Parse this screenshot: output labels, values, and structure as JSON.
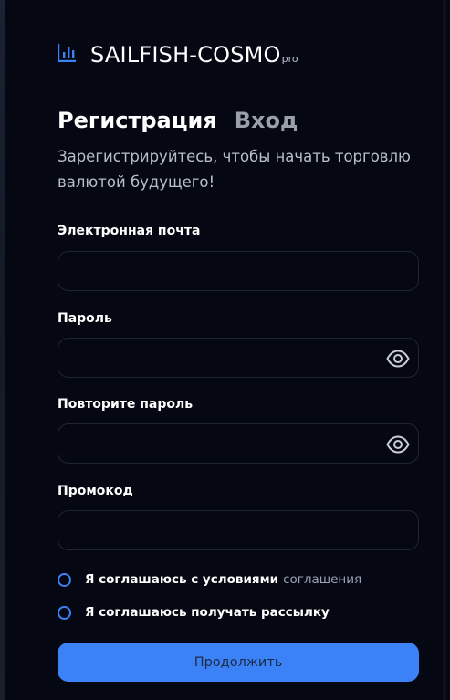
{
  "brand": {
    "name": "SAILFISH-COSMO",
    "suffix": "pro",
    "icon": "bar-chart-icon",
    "accent": "#3b82f6"
  },
  "tabs": {
    "register": "Регистрация",
    "login": "Вход"
  },
  "subtitle": "Зарегистрируйтесь, чтобы начать торговлю валютой будущего!",
  "fields": {
    "email": {
      "label": "Электронная почта",
      "value": "",
      "placeholder": ""
    },
    "password": {
      "label": "Пароль",
      "value": "",
      "placeholder": "",
      "icon": "eye-icon"
    },
    "password_repeat": {
      "label": "Повторите пароль",
      "value": "",
      "placeholder": "",
      "icon": "eye-icon"
    },
    "promo": {
      "label": "Промокод",
      "value": "",
      "placeholder": ""
    }
  },
  "checkboxes": {
    "terms_text": "Я соглашаюсь с условиями",
    "terms_link": "соглашения",
    "newsletter_text": "Я соглашаюсь получать рассылку"
  },
  "submit_label": "Продолжить"
}
